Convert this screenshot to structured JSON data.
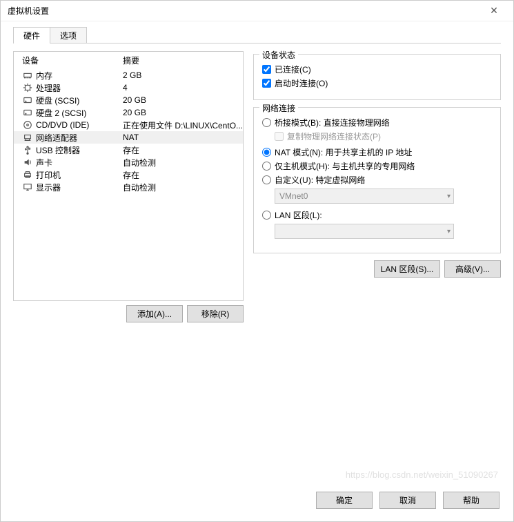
{
  "window": {
    "title": "虚拟机设置"
  },
  "tabs": {
    "hardware": "硬件",
    "options": "选项"
  },
  "headers": {
    "device": "设备",
    "summary": "摘要"
  },
  "devices": [
    {
      "icon": "memory",
      "label": "内存",
      "summary": "2 GB"
    },
    {
      "icon": "cpu",
      "label": "处理器",
      "summary": "4"
    },
    {
      "icon": "hdd",
      "label": "硬盘 (SCSI)",
      "summary": "20 GB"
    },
    {
      "icon": "hdd",
      "label": "硬盘 2 (SCSI)",
      "summary": "20 GB"
    },
    {
      "icon": "cd",
      "label": "CD/DVD (IDE)",
      "summary": "正在使用文件 D:\\LINUX\\CentO..."
    },
    {
      "icon": "network",
      "label": "网络适配器",
      "summary": "NAT"
    },
    {
      "icon": "usb",
      "label": "USB 控制器",
      "summary": "存在"
    },
    {
      "icon": "sound",
      "label": "声卡",
      "summary": "自动检测"
    },
    {
      "icon": "printer",
      "label": "打印机",
      "summary": "存在"
    },
    {
      "icon": "display",
      "label": "显示器",
      "summary": "自动检测"
    }
  ],
  "selectedDeviceIndex": 5,
  "leftButtons": {
    "add": "添加(A)...",
    "remove": "移除(R)"
  },
  "deviceStatus": {
    "title": "设备状态",
    "connected": "已连接(C)",
    "connectAtPowerOn": "启动时连接(O)"
  },
  "networkConn": {
    "title": "网络连接",
    "bridged": "桥接模式(B): 直接连接物理网络",
    "replicate": "复制物理网络连接状态(P)",
    "nat": "NAT 模式(N): 用于共享主机的 IP 地址",
    "hostOnly": "仅主机模式(H): 与主机共享的专用网络",
    "custom": "自定义(U): 特定虚拟网络",
    "customValue": "VMnet0",
    "lanSegment": "LAN 区段(L):",
    "lanSegmentBtn": "LAN 区段(S)...",
    "advancedBtn": "高级(V)..."
  },
  "footer": {
    "ok": "确定",
    "cancel": "取消",
    "help": "帮助"
  },
  "watermark": "https://blog.csdn.net/weixin_51090267"
}
